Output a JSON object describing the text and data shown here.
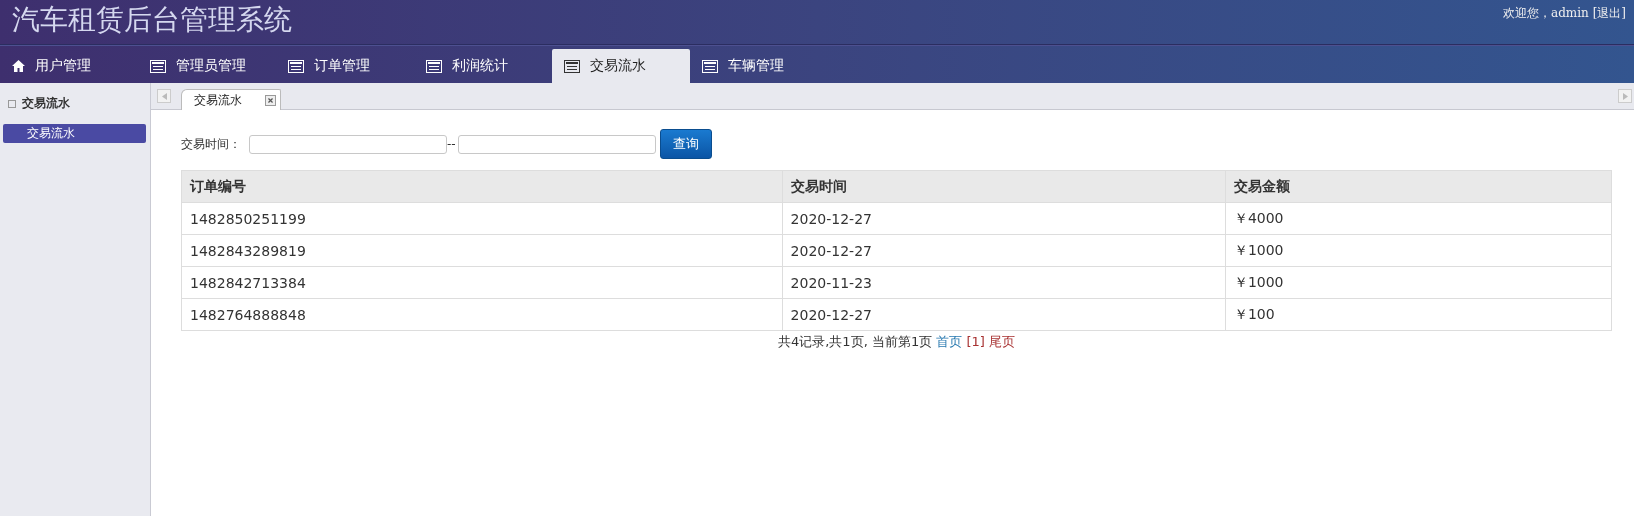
{
  "header": {
    "title": "汽车租赁后台管理系统",
    "welcome": "欢迎您，admin",
    "logout": "[退出]"
  },
  "nav_tabs": [
    {
      "label": "用户管理",
      "kind": "home",
      "selected": false
    },
    {
      "label": "管理员管理",
      "kind": "list",
      "selected": false
    },
    {
      "label": "订单管理",
      "kind": "list",
      "selected": false
    },
    {
      "label": "利润统计",
      "kind": "list",
      "selected": false
    },
    {
      "label": "交易流水",
      "kind": "list",
      "selected": true
    },
    {
      "label": "车辆管理",
      "kind": "list",
      "selected": false
    }
  ],
  "sidebar": {
    "title": "交易流水",
    "items": [
      {
        "label": "交易流水",
        "selected": true
      }
    ]
  },
  "page_tabs": [
    {
      "label": "交易流水",
      "selected": true
    }
  ],
  "search": {
    "label": "交易时间：",
    "separator": "--",
    "button": "查询"
  },
  "table": {
    "columns": [
      "订单编号",
      "交易时间",
      "交易金额"
    ],
    "rows": [
      [
        "1482850251199",
        "2020-12-27",
        "￥4000"
      ],
      [
        "1482843289819",
        "2020-12-27",
        "￥1000"
      ],
      [
        "1482842713384",
        "2020-11-23",
        "￥1000"
      ],
      [
        "1482764888848",
        "2020-12-27",
        "￥100"
      ]
    ]
  },
  "pagination": {
    "summary": "共4记录,共1页, 当前第1页",
    "links": [
      {
        "label": "首页",
        "color": "#2a7ab0"
      },
      {
        "label": "[1]",
        "color": "#a83232"
      },
      {
        "label": "尾页",
        "color": "#a83232"
      }
    ]
  }
}
